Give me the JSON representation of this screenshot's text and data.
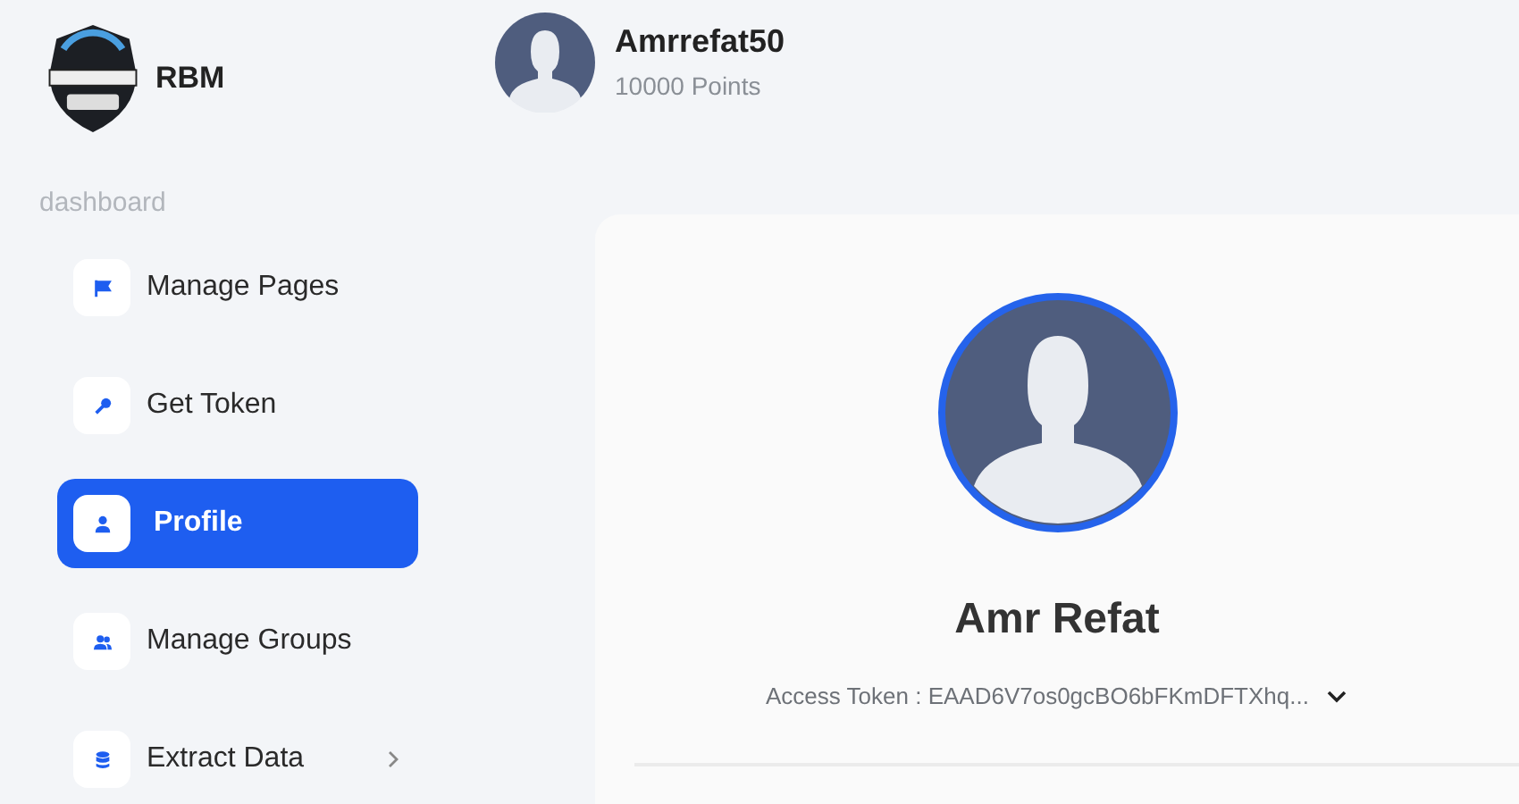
{
  "brand": {
    "name": "RBM"
  },
  "user": {
    "name": "Amrrefat50",
    "points": "10000 Points"
  },
  "sidebar": {
    "section": "dashboard",
    "items": [
      {
        "label": "Manage Pages",
        "kind": "flag",
        "selected": false,
        "has_submenu": false
      },
      {
        "label": "Get Token",
        "kind": "key",
        "selected": false,
        "has_submenu": false
      },
      {
        "label": "Profile",
        "kind": "user",
        "selected": true,
        "has_submenu": false
      },
      {
        "label": "Manage Groups",
        "kind": "users",
        "selected": false,
        "has_submenu": false
      },
      {
        "label": "Extract Data",
        "kind": "database",
        "selected": false,
        "has_submenu": true
      }
    ]
  },
  "profile": {
    "name": "Amr Refat",
    "token": "Access Token : EAAD6V7os0gcBO6bFKmDFTXhq...",
    "token_expanded": false
  }
}
